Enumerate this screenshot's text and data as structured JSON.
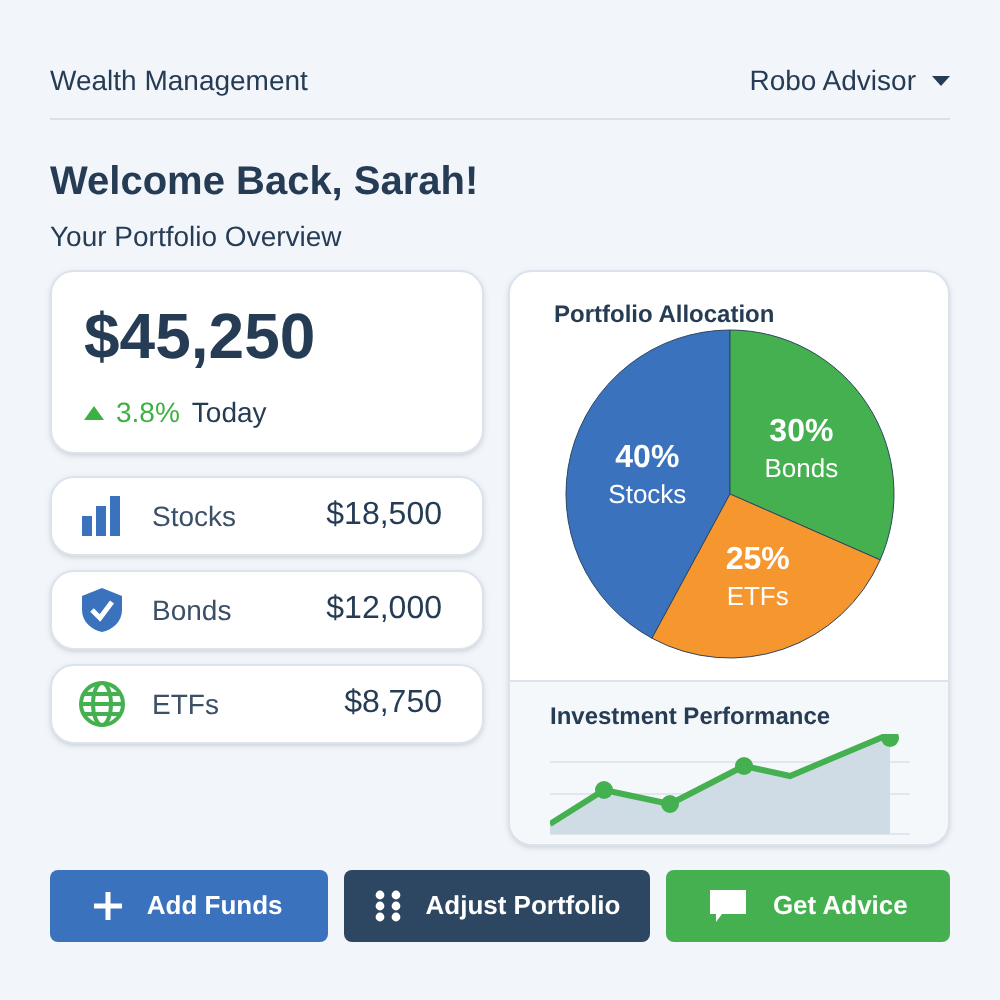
{
  "header": {
    "title": "Wealth Management",
    "menu": "Robo Advisor"
  },
  "welcome": {
    "title": "Welcome Back, Sarah!",
    "subtitle": "Your Portfolio Overview"
  },
  "total": {
    "value": "$45,250",
    "change": "3.8%",
    "period": "Today"
  },
  "holdings": [
    {
      "kind": "bars",
      "name": "Stocks",
      "value": "$18,500"
    },
    {
      "kind": "shield",
      "name": "Bonds",
      "value": "$12,000"
    },
    {
      "kind": "globe",
      "name": "ETFs",
      "value": "$8,750"
    }
  ],
  "allocation": {
    "title": "Portfolio Allocation",
    "chart_data": {
      "type": "pie",
      "categories": [
        "Stocks",
        "Bonds",
        "ETFs"
      ],
      "values": [
        40,
        30,
        25
      ],
      "colors": [
        "#3a72bd",
        "#45b04f",
        "#f5962f"
      ],
      "value_labels": [
        "40%",
        "30%",
        "25%"
      ]
    }
  },
  "performance": {
    "title": "Investment Performance"
  },
  "buttons": [
    {
      "kind": "plus",
      "label": "Add Funds",
      "color": "#3a72bd"
    },
    {
      "kind": "dots",
      "label": "Adjust Portfolio",
      "color": "#2d4661"
    },
    {
      "kind": "chat",
      "label": "Get Advice",
      "color": "#45b04f"
    }
  ]
}
